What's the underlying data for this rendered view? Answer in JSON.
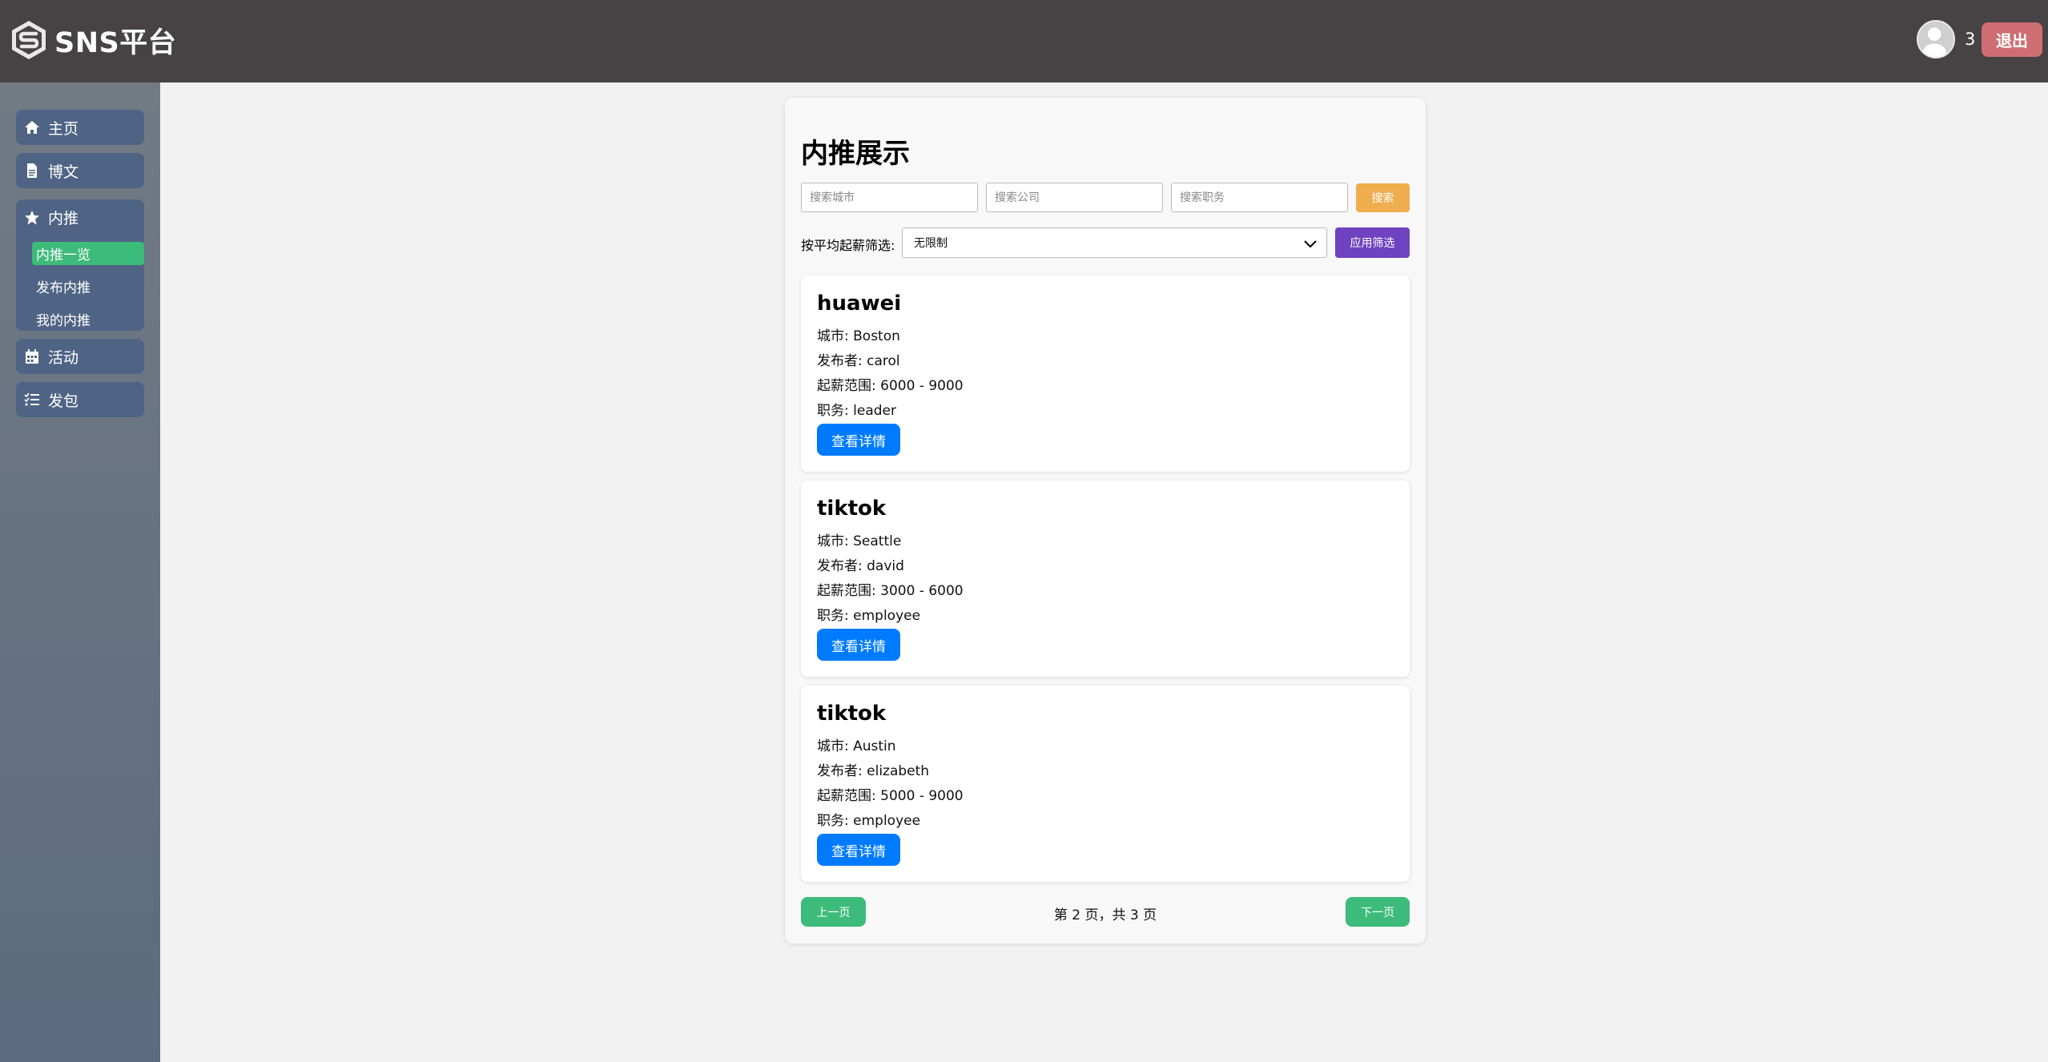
{
  "header": {
    "app_title": "SNS平台",
    "notification_count": "3",
    "logout_label": "退出"
  },
  "sidebar": {
    "items": [
      {
        "label": "主页",
        "icon": "home-icon"
      },
      {
        "label": "博文",
        "icon": "document-icon"
      },
      {
        "label": "内推",
        "icon": "star-icon"
      },
      {
        "label": "活动",
        "icon": "calendar-icon"
      },
      {
        "label": "发包",
        "icon": "list-icon"
      }
    ],
    "subitems": [
      {
        "label": "内推一览",
        "active": true
      },
      {
        "label": "发布内推",
        "active": false
      },
      {
        "label": "我的内推",
        "active": false
      }
    ]
  },
  "main": {
    "title": "内推展示",
    "search": {
      "city_placeholder": "搜索城市",
      "company_placeholder": "搜索公司",
      "position_placeholder": "搜索职务",
      "button_label": "搜索"
    },
    "filter": {
      "label": "按平均起薪筛选:",
      "selected": "无限制",
      "apply_label": "应用筛选"
    },
    "cards": [
      {
        "company": "huawei",
        "city": "城市: Boston",
        "poster": "发布者: carol",
        "salary": "起薪范围: 6000 - 9000",
        "position": "职务: leader",
        "button": "查看详情"
      },
      {
        "company": "tiktok",
        "city": "城市: Seattle",
        "poster": "发布者: david",
        "salary": "起薪范围: 3000 - 6000",
        "position": "职务: employee",
        "button": "查看详情"
      },
      {
        "company": "tiktok",
        "city": "城市: Austin",
        "poster": "发布者: elizabeth",
        "salary": "起薪范围: 5000 - 9000",
        "position": "职务: employee",
        "button": "查看详情"
      }
    ],
    "pagination": {
      "prev_label": "上一页",
      "info": "第 2 页，共 3 页",
      "next_label": "下一页"
    }
  },
  "colors": {
    "topbar": "#474345",
    "logout": "#cf6e72",
    "sidebar_item": "#4f6485",
    "active_subitem": "#3dbb7a",
    "search_button": "#f0ad4e",
    "apply_button": "#6f42c1",
    "detail_button": "#007bff",
    "pagination_button": "#3dbb7a"
  }
}
